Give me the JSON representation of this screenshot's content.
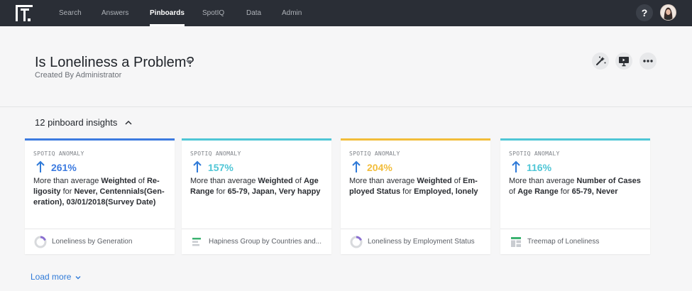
{
  "nav": {
    "items": [
      {
        "label": "Search",
        "active": false
      },
      {
        "label": "Answers",
        "active": false
      },
      {
        "label": "Pinboards",
        "active": true
      },
      {
        "label": "SpotIQ",
        "active": false
      },
      {
        "label": "Data",
        "active": false
      },
      {
        "label": "Admin",
        "active": false
      }
    ],
    "help_label": "?"
  },
  "header": {
    "title": "Is Loneliness a Problem?",
    "subtitle": "Created By Administrator"
  },
  "insights": {
    "label": "12 pinboard insights",
    "load_more": "Load more",
    "cards": [
      {
        "tag": "SPOTIQ ANOMALY",
        "percent": "261%",
        "accent": "#3d7be0",
        "desc_prefix": "More than average ",
        "measure": "Weighted",
        "desc_of": " of ",
        "attribute": "Re­ligosity",
        "desc_for": " for ",
        "values": "Never, Centennials(Gen­eration), 03/01/2018(Survey Date)",
        "foot_label": "Loneliness by Generation",
        "foot_icon": "donut-chart-icon"
      },
      {
        "tag": "SPOTIQ ANOMALY",
        "percent": "157%",
        "accent": "#4fc6d6",
        "desc_prefix": "More than average ",
        "measure": "Weighted",
        "desc_of": " of ",
        "attribute": "Age Range",
        "desc_for": " for ",
        "values": "65-79, Japan, Very happy",
        "foot_label": "Hapiness Group by Countries and...",
        "foot_icon": "bar-chart-icon"
      },
      {
        "tag": "SPOTIQ ANOMALY",
        "percent": "204%",
        "accent": "#f2bd3a",
        "desc_prefix": "More than average ",
        "measure": "Weighted",
        "desc_of": " of ",
        "attribute": "Em­ployed Status",
        "desc_for": " for ",
        "values": "Employed, lonely",
        "foot_label": "Loneliness by Employment Status",
        "foot_icon": "donut-chart-icon"
      },
      {
        "tag": "SPOTIQ ANOMALY",
        "percent": "116%",
        "accent": "#4fc6d6",
        "desc_prefix": "More than average ",
        "measure": "Number of Cases",
        "desc_of": " of ",
        "attribute": "Age Range",
        "desc_for": " for ",
        "values": "65-79, Never",
        "foot_label": "Treemap of Loneliness",
        "foot_icon": "treemap-icon"
      }
    ]
  },
  "colors": {
    "topbar": "#2a2e36",
    "link_blue": "#2f7ad8",
    "arrow_blue": "#2f7ad8"
  }
}
